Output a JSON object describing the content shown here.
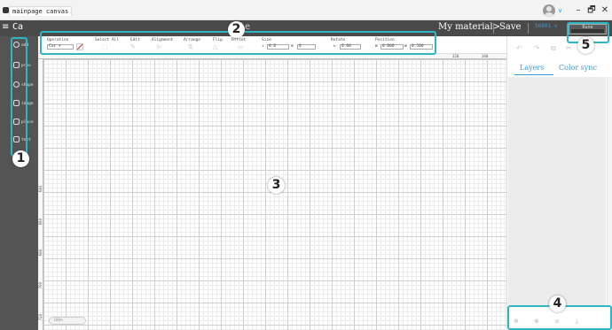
{
  "titlebar": {
    "tab": "mainpage canvas",
    "minimize": "–",
    "maximize": "🗗",
    "close": "✕",
    "avatar_chevron": "∨"
  },
  "header": {
    "menu_icon": "≡",
    "project_title": "Ca",
    "center_title": "le",
    "my_material": "My material>",
    "save": "Save",
    "device": "S6801",
    "device_chevron": "∨",
    "run_button": "Rune"
  },
  "sidebar": {
    "items": [
      {
        "label": "add",
        "icon": "add-icon"
      },
      {
        "label": "prev",
        "icon": "preview-icon"
      },
      {
        "label": "shape",
        "icon": "shape-icon"
      },
      {
        "label": "image",
        "icon": "image-icon"
      },
      {
        "label": "place",
        "icon": "place-icon"
      },
      {
        "label": "text",
        "icon": "text-icon"
      }
    ]
  },
  "toolbar": {
    "operation_label": "Operation",
    "operation_value": "Cut",
    "select_all_label": "Select All",
    "edit_label": "Edit",
    "alignment_label": "Alignment",
    "arrange_label": "Arrange",
    "flip_label": "Flip",
    "offset_label": "Offset",
    "size_label": "Size",
    "size_w": "0.0",
    "size_h": "0",
    "rotate_label": "Rotate",
    "rotate_value": "0.00",
    "position_label": "Position",
    "position_x": "0.000",
    "position_y": "0.500"
  },
  "ruler": {
    "top_ticks": [
      "320",
      "340"
    ],
    "left_ticks": [
      "640",
      "660",
      "680",
      "700",
      "720"
    ]
  },
  "canvas": {
    "zoom_label": "100%"
  },
  "right_panel": {
    "tab_layers": "Layers",
    "tab_color_sync": "Color sync"
  },
  "annotations": [
    "1",
    "2",
    "3",
    "4",
    "5"
  ],
  "colors": {
    "accent": "#3b9bd6",
    "highlight": "#2fb6c4",
    "header_bg": "#4a4a4a",
    "sidebar_bg": "#545454"
  }
}
